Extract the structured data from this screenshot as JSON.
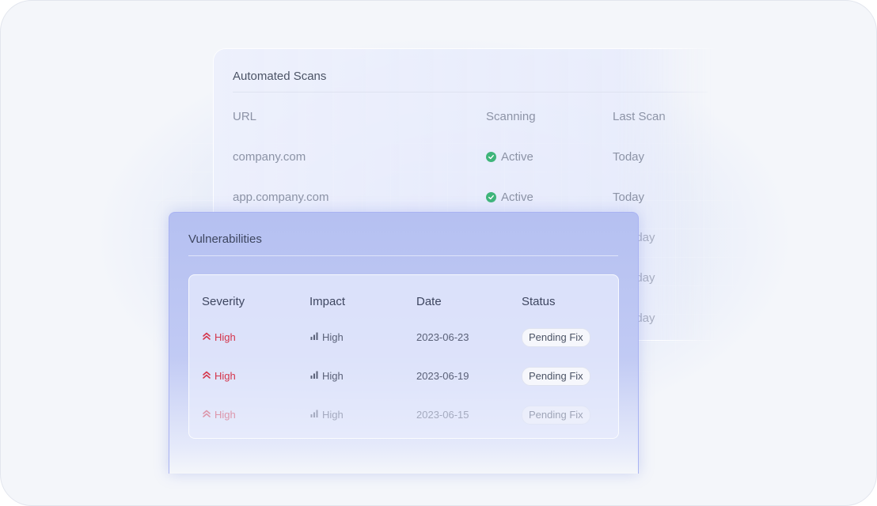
{
  "scans": {
    "title": "Automated Scans",
    "columns": [
      "URL",
      "Scanning",
      "Last Scan"
    ],
    "rows": [
      {
        "url": "company.com",
        "scanning": "Active",
        "last_scan": "Today"
      },
      {
        "url": "app.company.com",
        "scanning": "Active",
        "last_scan": "Today"
      },
      {
        "url": "",
        "scanning": "",
        "last_scan": "erday"
      },
      {
        "url": "",
        "scanning": "",
        "last_scan": "erday"
      },
      {
        "url": "",
        "scanning": "",
        "last_scan": "erday"
      }
    ],
    "active_icon": "check-circle-icon",
    "active_color": "#3fb57a"
  },
  "vulnerabilities": {
    "title": "Vulnerabilities",
    "columns": [
      "Severity",
      "Impact",
      "Date",
      "Status"
    ],
    "rows": [
      {
        "severity": "High",
        "impact": "High",
        "date": "2023-06-23",
        "status": "Pending Fix"
      },
      {
        "severity": "High",
        "impact": "High",
        "date": "2023-06-19",
        "status": "Pending Fix"
      },
      {
        "severity": "High",
        "impact": "High",
        "date": "2023-06-15",
        "status": "Pending Fix"
      }
    ],
    "severity_icon": "double-chevron-up-icon",
    "impact_icon": "signal-bars-icon",
    "severity_color": "#d4344a"
  }
}
